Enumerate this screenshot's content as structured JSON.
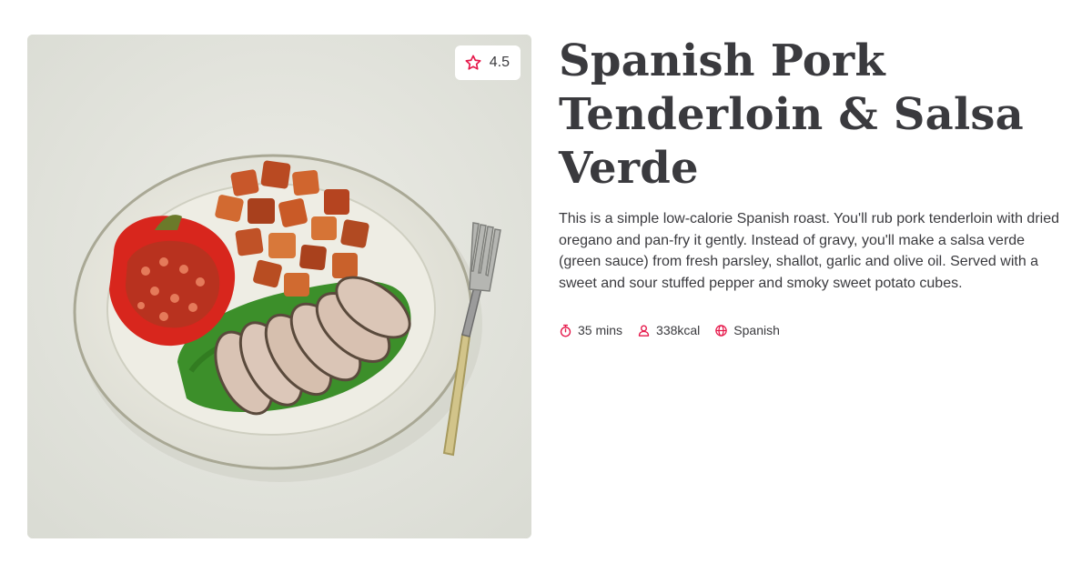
{
  "recipe": {
    "title": "Spanish Pork Tenderloin & Salsa Verde",
    "rating": "4.5",
    "description": "This is a simple low-calorie Spanish roast. You'll rub pork tenderloin with dried oregano and pan-fry it gently. Instead of gravy, you'll make a salsa verde (green sauce) from fresh parsley, shallot, garlic and olive oil. Served with a sweet and sour stuffed pepper and smoky sweet potato cubes.",
    "meta": [
      {
        "icon": "timer-icon",
        "text": "35 mins"
      },
      {
        "icon": "person-icon",
        "text": "338kcal"
      },
      {
        "icon": "globe-icon",
        "text": "Spanish"
      }
    ]
  },
  "colors": {
    "accent": "#e6194b",
    "text": "#3a3a3e",
    "background": "#ffffff"
  }
}
